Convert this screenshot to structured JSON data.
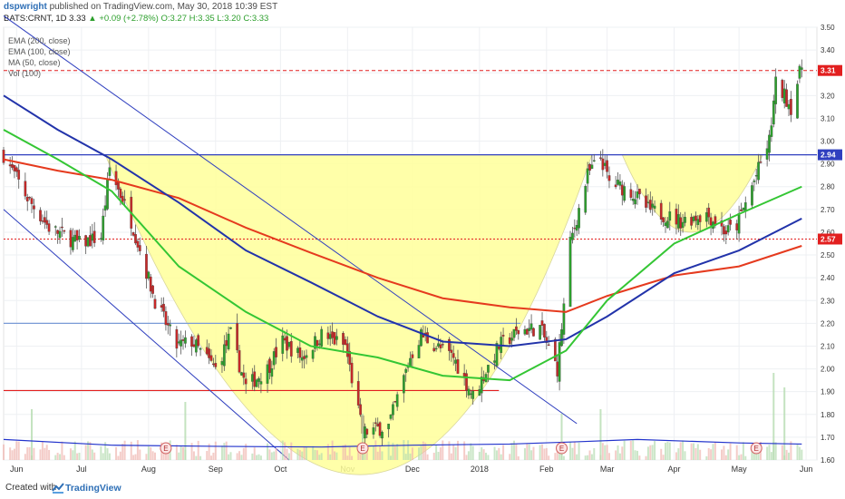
{
  "header": {
    "author": "dspwright",
    "published": "published on TradingView.com, May 30, 2018 10:39 EST",
    "symbol": "BATS:CRNT, 1D",
    "last": "3.33",
    "change_icon": "triangle-up-icon",
    "change": "+0.09 (+2.78%)",
    "ohlc": "O:3.27 H:3.35 L:3.20 C:3.33"
  },
  "legend": [
    "EMA (200, close)",
    "EMA (100, close)",
    "MA (50, close)",
    "Vol (100)"
  ],
  "price_tags": [
    {
      "value": 3.31,
      "label": "3.31",
      "color": "#e21f1f"
    },
    {
      "value": 2.94,
      "label": "2.94",
      "color": "#2f3fbf"
    },
    {
      "value": 2.57,
      "label": "2.57",
      "color": "#e21f1f"
    }
  ],
  "footer": {
    "created": "Created with",
    "brand": "TradingView",
    "logo_icon": "tradingview-logo-icon"
  },
  "colors": {
    "up": "#2c9f2c",
    "down": "#c62828",
    "ema200": "#e53a1e",
    "ema100": "#2233aa",
    "ma50": "#34c634",
    "fill": "#ffff9a",
    "vol": "#2233cc"
  },
  "chart_data": {
    "type": "candlestick",
    "symbol": "BATS:CRNT",
    "interval": "1D",
    "x_range": [
      "2018-05-28",
      "2019-06-03"
    ],
    "ylim": [
      1.6,
      3.5
    ],
    "y_ticks": [
      "3.50",
      "3.40",
      "3.30",
      "3.20",
      "3.10",
      "3.00",
      "2.90",
      "2.80",
      "2.70",
      "2.60",
      "2.50",
      "2.40",
      "2.30",
      "2.20",
      "2.10",
      "2.00",
      "1.90",
      "1.80",
      "1.70",
      "1.60"
    ],
    "x_ticks": [
      {
        "date": "2017-06-01",
        "label": "Jun"
      },
      {
        "date": "2017-07-01",
        "label": "Jul"
      },
      {
        "date": "2017-08-01",
        "label": "Aug"
      },
      {
        "date": "2017-09-01",
        "label": "Sep"
      },
      {
        "date": "2017-10-01",
        "label": "Oct"
      },
      {
        "date": "2017-11-01",
        "label": "Nov"
      },
      {
        "date": "2017-12-01",
        "label": "Dec"
      },
      {
        "date": "2018-01-01",
        "label": "2018"
      },
      {
        "date": "2018-02-01",
        "label": "Feb"
      },
      {
        "date": "2018-03-01",
        "label": "Mar"
      },
      {
        "date": "2018-04-01",
        "label": "Apr"
      },
      {
        "date": "2018-05-01",
        "label": "May"
      },
      {
        "date": "2018-06-01",
        "label": "Jun"
      }
    ],
    "x_start": "2017-05-26",
    "x_end": "2018-06-06",
    "close_anchors": [
      [
        "2017-05-26",
        2.94
      ],
      [
        "2017-06-06",
        2.75
      ],
      [
        "2017-06-16",
        2.62
      ],
      [
        "2017-06-30",
        2.55
      ],
      [
        "2017-07-10",
        2.58
      ],
      [
        "2017-07-14",
        2.88
      ],
      [
        "2017-07-24",
        2.65
      ],
      [
        "2017-08-04",
        2.3
      ],
      [
        "2017-08-14",
        2.1
      ],
      [
        "2017-08-21",
        2.12
      ],
      [
        "2017-09-01",
        2.0
      ],
      [
        "2017-09-08",
        2.15
      ],
      [
        "2017-09-15",
        1.92
      ],
      [
        "2017-09-25",
        2.0
      ],
      [
        "2017-10-02",
        2.12
      ],
      [
        "2017-10-11",
        2.05
      ],
      [
        "2017-10-20",
        2.15
      ],
      [
        "2017-10-31",
        2.1
      ],
      [
        "2017-11-08",
        1.72
      ],
      [
        "2017-11-20",
        1.75
      ],
      [
        "2017-11-30",
        2.05
      ],
      [
        "2017-12-05",
        2.15
      ],
      [
        "2017-12-12",
        2.1
      ],
      [
        "2017-12-20",
        2.05
      ],
      [
        "2017-12-29",
        1.88
      ],
      [
        "2018-01-10",
        2.1
      ],
      [
        "2018-01-20",
        2.17
      ],
      [
        "2018-01-29",
        2.18
      ],
      [
        "2018-02-06",
        2.0
      ],
      [
        "2018-02-12",
        2.55
      ],
      [
        "2018-02-20",
        2.85
      ],
      [
        "2018-02-26",
        2.93
      ],
      [
        "2018-03-02",
        2.82
      ],
      [
        "2018-03-12",
        2.78
      ],
      [
        "2018-03-20",
        2.7
      ],
      [
        "2018-04-04",
        2.65
      ],
      [
        "2018-04-16",
        2.68
      ],
      [
        "2018-04-25",
        2.6
      ],
      [
        "2018-04-30",
        2.63
      ],
      [
        "2018-05-09",
        2.85
      ],
      [
        "2018-05-15",
        3.0
      ],
      [
        "2018-05-18",
        3.25
      ],
      [
        "2018-05-22",
        3.2
      ],
      [
        "2018-05-25",
        3.15
      ],
      [
        "2018-05-30",
        3.33
      ]
    ],
    "series": [
      {
        "name": "EMA (200, close)",
        "color": "#e53a1e",
        "points": [
          [
            "2017-05-26",
            2.92
          ],
          [
            "2017-06-20",
            2.87
          ],
          [
            "2017-07-15",
            2.83
          ],
          [
            "2017-08-15",
            2.75
          ],
          [
            "2017-09-15",
            2.62
          ],
          [
            "2017-10-15",
            2.51
          ],
          [
            "2017-11-15",
            2.4
          ],
          [
            "2017-12-15",
            2.31
          ],
          [
            "2018-01-15",
            2.27
          ],
          [
            "2018-02-10",
            2.25
          ],
          [
            "2018-03-01",
            2.32
          ],
          [
            "2018-04-01",
            2.41
          ],
          [
            "2018-05-01",
            2.45
          ],
          [
            "2018-05-30",
            2.54
          ]
        ]
      },
      {
        "name": "EMA (100, close)",
        "color": "#2233aa",
        "points": [
          [
            "2017-05-26",
            3.2
          ],
          [
            "2017-06-20",
            3.05
          ],
          [
            "2017-07-15",
            2.92
          ],
          [
            "2017-08-15",
            2.73
          ],
          [
            "2017-09-15",
            2.52
          ],
          [
            "2017-10-15",
            2.38
          ],
          [
            "2017-11-15",
            2.23
          ],
          [
            "2017-12-15",
            2.12
          ],
          [
            "2018-01-15",
            2.1
          ],
          [
            "2018-02-10",
            2.13
          ],
          [
            "2018-03-01",
            2.23
          ],
          [
            "2018-04-01",
            2.42
          ],
          [
            "2018-05-01",
            2.52
          ],
          [
            "2018-05-30",
            2.66
          ]
        ]
      },
      {
        "name": "MA (50, close)",
        "color": "#34c634",
        "points": [
          [
            "2017-05-26",
            3.05
          ],
          [
            "2017-06-20",
            2.92
          ],
          [
            "2017-07-15",
            2.78
          ],
          [
            "2017-08-15",
            2.45
          ],
          [
            "2017-09-15",
            2.25
          ],
          [
            "2017-10-15",
            2.1
          ],
          [
            "2017-11-15",
            2.05
          ],
          [
            "2017-12-15",
            1.97
          ],
          [
            "2018-01-15",
            1.95
          ],
          [
            "2018-02-10",
            2.08
          ],
          [
            "2018-03-01",
            2.3
          ],
          [
            "2018-04-01",
            2.55
          ],
          [
            "2018-05-01",
            2.68
          ],
          [
            "2018-05-30",
            2.8
          ]
        ]
      }
    ],
    "volume_ma": [
      [
        "2017-05-26",
        1.69
      ],
      [
        "2017-07-15",
        1.665
      ],
      [
        "2017-09-01",
        1.66
      ],
      [
        "2017-10-20",
        1.657
      ],
      [
        "2017-12-01",
        1.665
      ],
      [
        "2018-01-15",
        1.67
      ],
      [
        "2018-02-15",
        1.68
      ],
      [
        "2018-03-15",
        1.69
      ],
      [
        "2018-05-01",
        1.675
      ],
      [
        "2018-05-30",
        1.67
      ]
    ],
    "volume_spikes": [
      [
        "2017-06-08",
        3.5
      ],
      [
        "2017-08-18",
        4
      ],
      [
        "2017-11-08",
        3.2
      ],
      [
        "2018-02-08",
        3.2
      ],
      [
        "2018-02-26",
        3.5
      ],
      [
        "2018-05-17",
        6
      ],
      [
        "2018-05-22",
        5
      ]
    ],
    "earnings": [
      "2017-08-09",
      "2017-11-08",
      "2018-02-08",
      "2018-05-09"
    ],
    "earnings_label": "E",
    "horizontal_lines": [
      {
        "y": 2.94,
        "color": "#2f3fbf",
        "style": "solid",
        "from": "2017-05-26",
        "to": "2018-06-06"
      },
      {
        "y": 3.31,
        "color": "#e21f1f",
        "style": "dashed",
        "from": "2017-05-26",
        "to": "2018-06-06"
      },
      {
        "y": 2.57,
        "color": "#e21f1f",
        "style": "dotted",
        "from": "2017-05-26",
        "to": "2018-06-06"
      },
      {
        "y": 1.905,
        "color": "#e21f1f",
        "style": "solid",
        "from": "2017-05-26",
        "to": "2018-01-10"
      },
      {
        "y": 2.2,
        "color": "#7a9bd6",
        "style": "solid",
        "from": "2017-05-26",
        "to": "2018-01-20"
      }
    ],
    "trend_lines": [
      {
        "x1": "2017-05-26",
        "y1": 3.55,
        "x2": "2018-02-15",
        "y2": 1.76,
        "color": "#2f3fbf"
      },
      {
        "x1": "2017-05-26",
        "y1": 2.7,
        "x2": "2017-10-05",
        "y2": 1.6,
        "color": "#2f3fbf"
      }
    ],
    "cup_shape": {
      "left_rim": [
        "2017-07-12",
        2.94
      ],
      "bottom": [
        "2017-11-12",
        1.655
      ],
      "right_rim": [
        "2018-02-22",
        2.94
      ],
      "handle_left": [
        "2018-03-08",
        2.94
      ],
      "handle_bottom": [
        "2018-04-08",
        2.6
      ],
      "handle_right": [
        "2018-05-12",
        2.94
      ]
    },
    "grid": true,
    "legend_position": "top-left"
  }
}
